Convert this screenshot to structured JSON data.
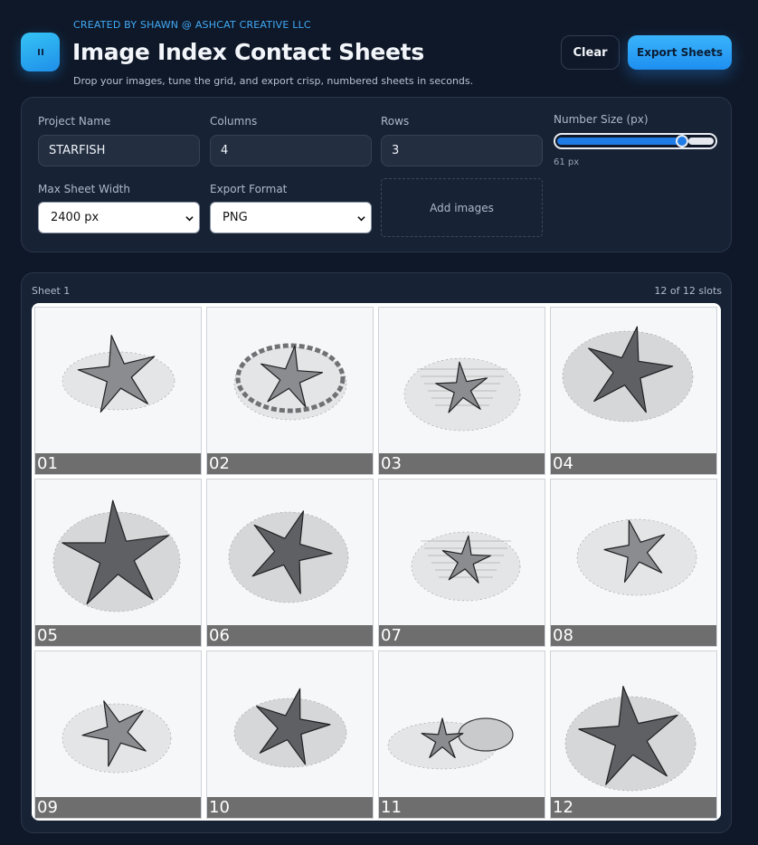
{
  "header": {
    "credit": "CREATED BY SHAWN @ ASHCAT CREATIVE LLC",
    "title": "Image Index Contact Sheets",
    "subtitle": "Drop your images, tune the grid, and export crisp, numbered sheets in seconds.",
    "logo_icon": "pause-bars-icon",
    "clear_label": "Clear",
    "export_label": "Export Sheets",
    "accent": "#2a9df4"
  },
  "settings": {
    "project_name_label": "Project Name",
    "project_name_value": "STARFISH",
    "columns_label": "Columns",
    "columns_value": "4",
    "rows_label": "Rows",
    "rows_value": "3",
    "number_size_label": "Number Size (px)",
    "number_size_value": "61 px",
    "number_size_fraction": 0.81,
    "max_width_label": "Max Sheet Width",
    "max_width_value": "2400 px",
    "export_format_label": "Export Format",
    "export_format_value": "PNG",
    "dropzone_label": "Add images"
  },
  "sheet": {
    "label": "Sheet 1",
    "count": "12 of 12 slots",
    "cells": [
      "01",
      "02",
      "03",
      "04",
      "05",
      "06",
      "07",
      "08",
      "09",
      "10",
      "11",
      "12"
    ]
  }
}
